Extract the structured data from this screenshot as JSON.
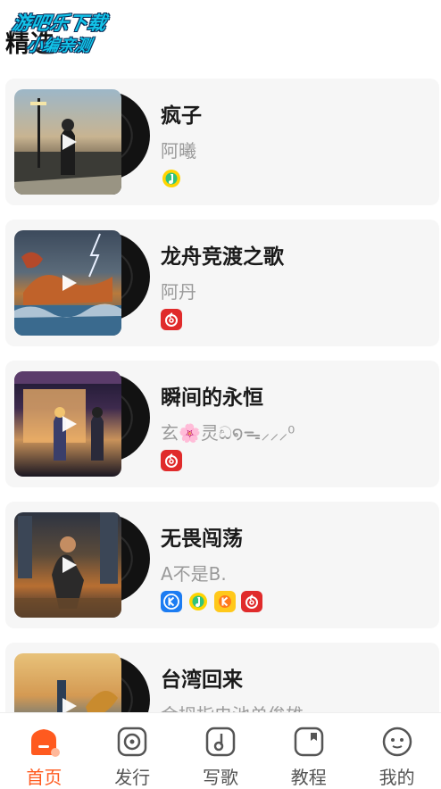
{
  "header": {
    "title": "精选",
    "watermark_line1": "游吧乐下载",
    "watermark_line2": "小编亲测"
  },
  "songs": [
    {
      "title": "疯子",
      "artist": "阿曦",
      "platforms": [
        "qq-music-icon"
      ]
    },
    {
      "title": "龙舟竞渡之歌",
      "artist": "阿丹",
      "platforms": [
        "netease-music-icon"
      ]
    },
    {
      "title": "瞬间的永恒",
      "artist": "玄🌸灵ඩ໑ᯓ⸝⸝⸝⁰",
      "platforms": [
        "netease-music-icon"
      ]
    },
    {
      "title": "无畏闯荡",
      "artist": "A不是B.",
      "platforms": [
        "kugou-icon",
        "qq-music-icon",
        "kuwo-icon",
        "netease-music-icon"
      ]
    },
    {
      "title": "台湾回来",
      "artist": "金拇指电池单俊雄",
      "platforms": []
    }
  ],
  "tabbar": {
    "items": [
      {
        "label": "首页",
        "icon": "home-icon",
        "active": true
      },
      {
        "label": "发行",
        "icon": "vinyl-icon",
        "active": false
      },
      {
        "label": "写歌",
        "icon": "music-note-icon",
        "active": false
      },
      {
        "label": "教程",
        "icon": "book-icon",
        "active": false
      },
      {
        "label": "我的",
        "icon": "face-icon",
        "active": false
      }
    ]
  },
  "colors": {
    "accent": "#ff5a1f",
    "card_bg": "#f6f6f6",
    "netease_red": "#e02b2b",
    "qq_green": "#31c27c",
    "qq_yellow": "#ffd400",
    "kugou_blue": "#1c7cf2",
    "kuwo_yellow": "#ffc81a"
  }
}
